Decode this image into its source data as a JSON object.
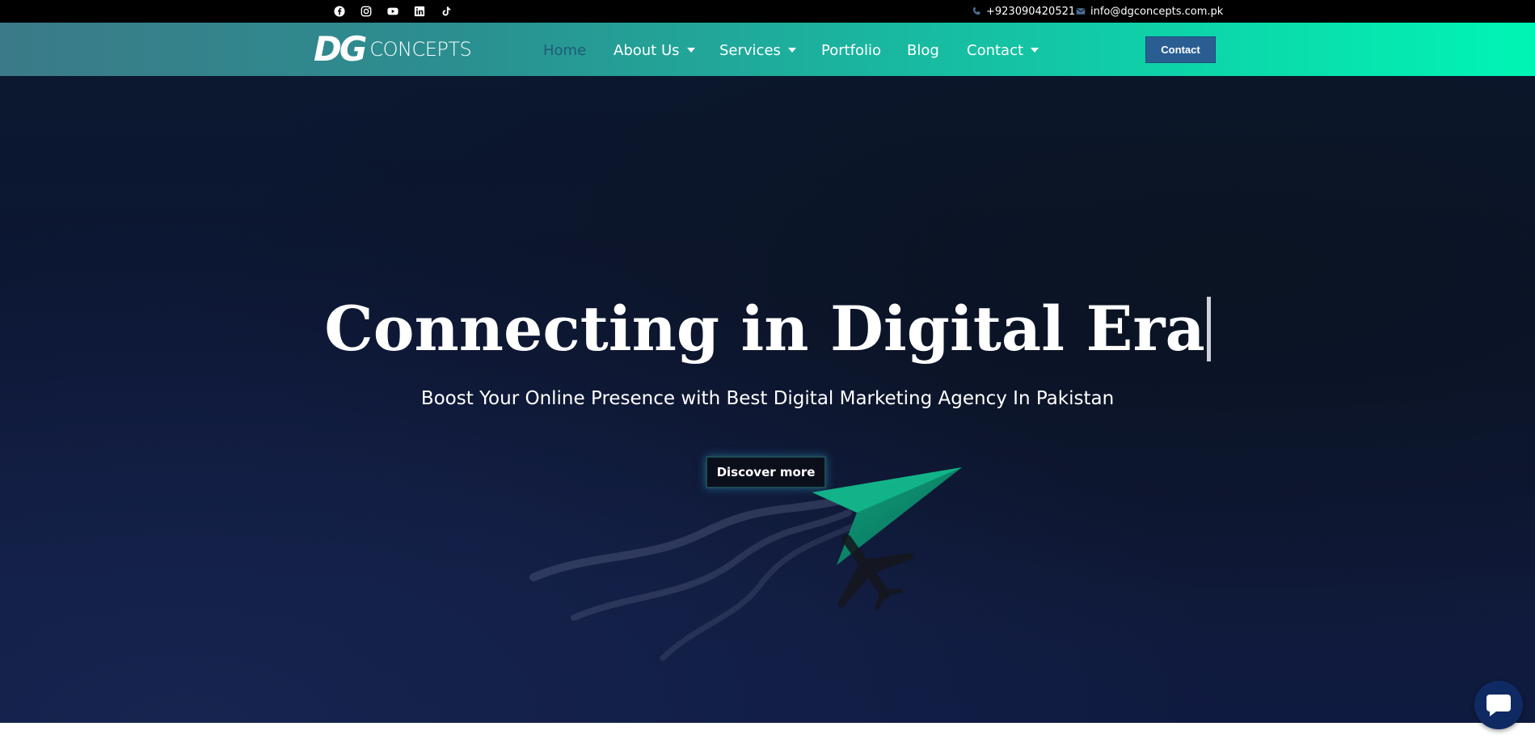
{
  "topbar": {
    "social_icons": [
      "facebook-icon",
      "instagram-icon",
      "youtube-icon",
      "linkedin-icon",
      "tiktok-icon"
    ],
    "phone": "+923090420521",
    "email": "info@dgconcepts.com.pk"
  },
  "header": {
    "logo": {
      "mark": "DG",
      "word": "CONCEPTS"
    },
    "nav": [
      {
        "label": "Home",
        "active": true,
        "dropdown": false
      },
      {
        "label": "About Us",
        "active": false,
        "dropdown": true
      },
      {
        "label": "Services",
        "active": false,
        "dropdown": true
      },
      {
        "label": "Portfolio",
        "active": false,
        "dropdown": false
      },
      {
        "label": "Blog",
        "active": false,
        "dropdown": false
      },
      {
        "label": "Contact",
        "active": false,
        "dropdown": true
      }
    ],
    "cta_label": "Contact"
  },
  "hero": {
    "title": "Connecting in Digital Era",
    "subtitle": "Boost Your Online Presence with Best Digital Marketing Agency In Pakistan",
    "button_label": "Discover more"
  },
  "colors": {
    "topbar_bg": "#000000",
    "header_gradient_start": "#3b7a88",
    "header_gradient_end": "#00f5b5",
    "cta_bg": "#2a5e93",
    "active_nav": "#1f5b78",
    "hero_bg": "#0c1532",
    "chat_bg": "#0f2a63"
  }
}
